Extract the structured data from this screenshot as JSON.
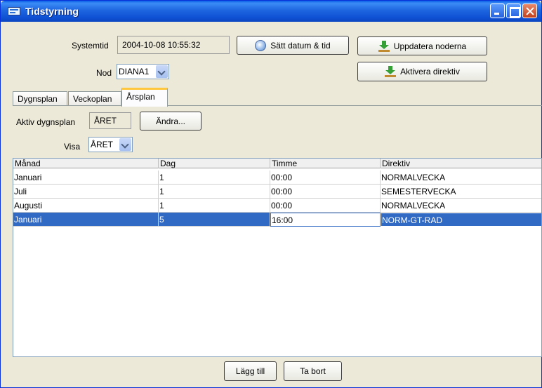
{
  "window": {
    "title": "Tidstyrning"
  },
  "system": {
    "time_label": "Systemtid",
    "time_value": "2004-10-08 10:55:32",
    "set_datetime_label": "Sätt datum & tid",
    "update_nodes_label": "Uppdatera noderna",
    "activate_directive_label": "Aktivera direktiv",
    "node_label": "Nod",
    "node_value": "DIANA1"
  },
  "tabs": [
    {
      "label": "Dygnsplan"
    },
    {
      "label": "Veckoplan"
    },
    {
      "label": "Årsplan",
      "active": true
    }
  ],
  "panel": {
    "active_plan_label": "Aktiv dygnsplan",
    "active_plan_value": "ÅRET",
    "change_label": "Ändra...",
    "show_label": "Visa",
    "show_value": "ÅRET"
  },
  "table": {
    "columns": [
      "Månad",
      "Dag",
      "Timme",
      "Direktiv"
    ],
    "rows": [
      [
        "Januari",
        "1",
        "00:00",
        "NORMALVECKA"
      ],
      [
        "Juli",
        "1",
        "00:00",
        "SEMESTERVECKA"
      ],
      [
        "Augusti",
        "1",
        "00:00",
        "NORMALVECKA"
      ],
      [
        "Januari",
        "5",
        "16:00",
        "NORM-GT-RAD"
      ]
    ],
    "selected_row": 3
  },
  "footer": {
    "add_label": "Lägg till",
    "remove_label": "Ta bort"
  },
  "colors": {
    "title_bar": "#0f51d4",
    "selection": "#316ac5",
    "tab_highlight": "#ffc83c",
    "background": "#ece9d8"
  }
}
